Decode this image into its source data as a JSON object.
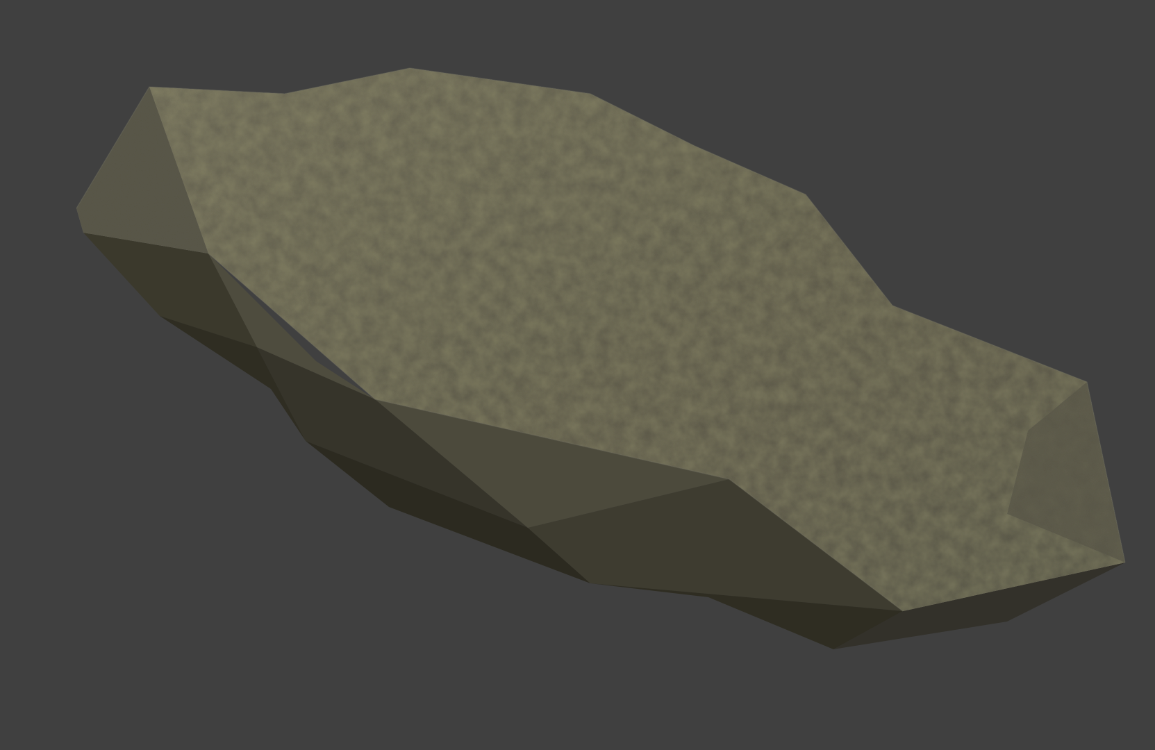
{
  "scene": {
    "background_color": "#404040",
    "object": "rock-mesh",
    "material": "mossy-rock-texture",
    "colors": {
      "rock_top": "#5e5b4d",
      "rock_top_light": "#6a6758",
      "rock_side": "#4a483a",
      "rock_shadow": "#2f2d22",
      "moss": "#6b6a3e"
    }
  }
}
